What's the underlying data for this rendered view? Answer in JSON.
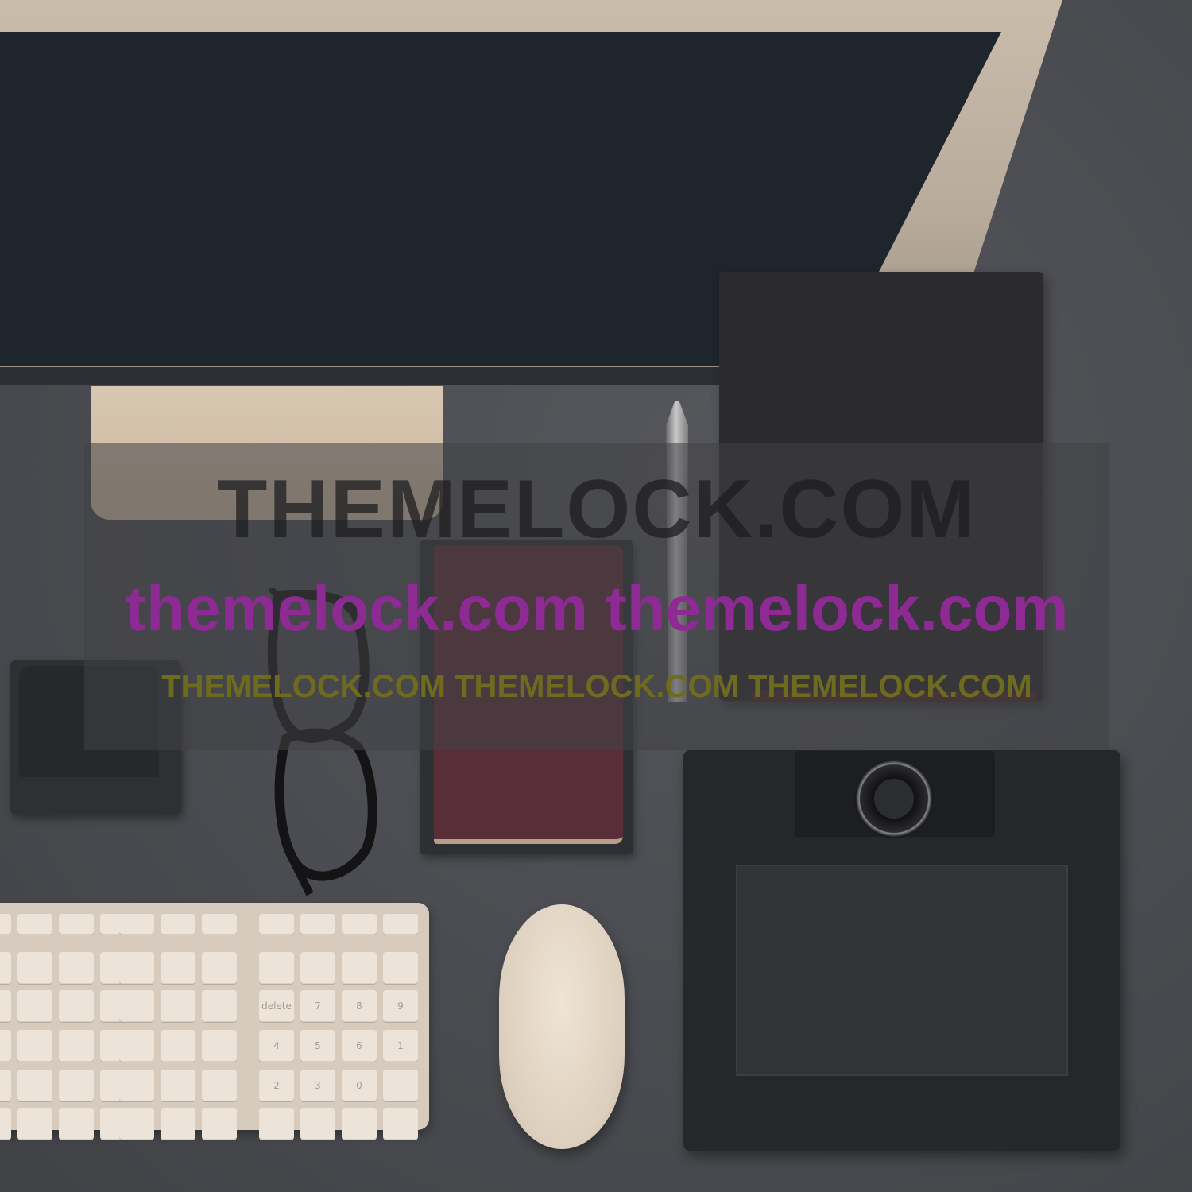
{
  "watermark": {
    "line1": "THEMELOCK.COM",
    "line2": "themelock.com themelock.com",
    "line3": "THEMELOCK.COM THEMELOCK.COM THEMELOCK.COM"
  },
  "colors": {
    "desk": "#4a4c50",
    "screen": "#1f252d",
    "monitor_frame": "#b8ab9b",
    "passport": "#5a2e38",
    "watermark_magenta": "#8e2a94",
    "watermark_olive": "#6e6a1f"
  },
  "objects": [
    "monitor",
    "monitor-stand",
    "black-notebook",
    "pen",
    "passport",
    "phone-dock",
    "glasses",
    "keyboard",
    "mouse",
    "drawing-tablet"
  ],
  "keyboard": {
    "key_labels": [
      "delete",
      "7",
      "8",
      "9",
      "4",
      "5",
      "6",
      "1",
      "2",
      "3",
      "0"
    ]
  }
}
